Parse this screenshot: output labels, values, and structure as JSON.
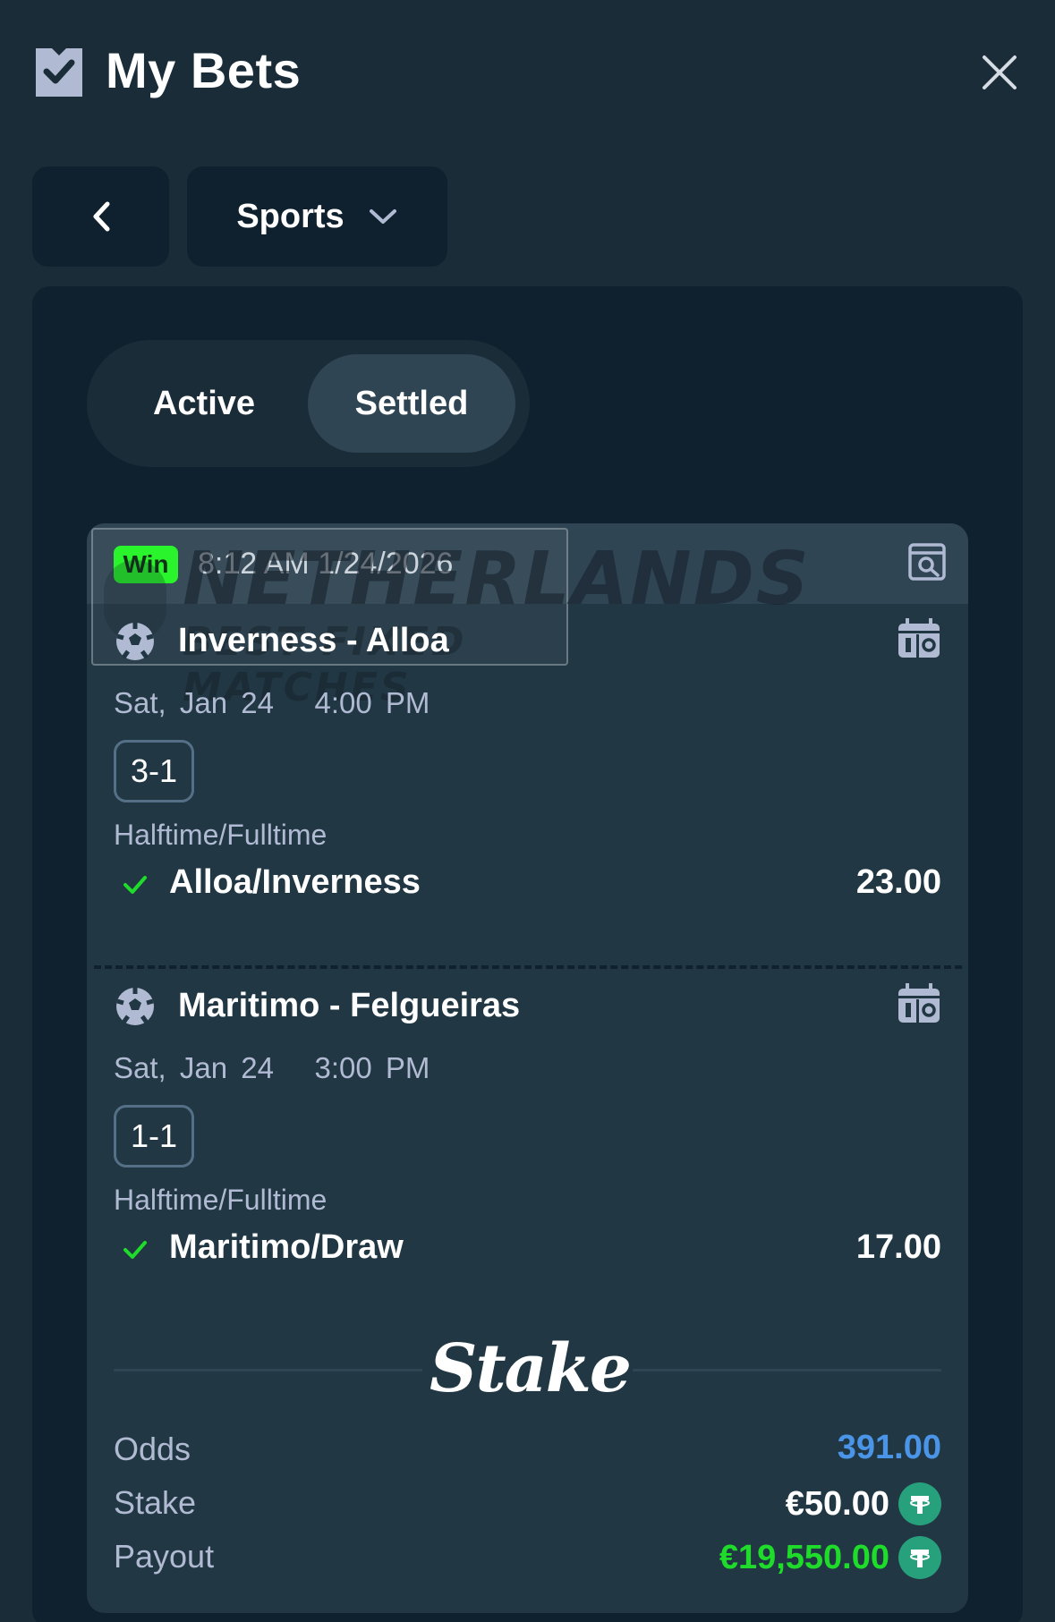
{
  "header": {
    "title": "My Bets",
    "icon": "ticket-icon",
    "close_icon": "close-icon"
  },
  "nav": {
    "back_icon": "chevron-left-icon",
    "sports_label": "Sports",
    "sports_icon": "chevron-down-icon"
  },
  "tabs": [
    {
      "label": "Active",
      "selected": false
    },
    {
      "label": "Settled",
      "selected": true
    }
  ],
  "bet": {
    "status": "Win",
    "status_color": "#1fff20",
    "placed_at": "8:12 AM 1/24/2026",
    "watermark": {
      "line1": "NETHERLANDS",
      "line2": "BEST FIXED MATCHES"
    },
    "legs": [
      {
        "match": "Inverness - Alloa",
        "date": "Sat, Jan 24",
        "time": "4:00 PM",
        "score": "3-1",
        "market": "Halftime/Fulltime",
        "selection": "Alloa/Inverness",
        "odds": "23.00"
      },
      {
        "match": "Maritimo - Felgueiras",
        "date": "Sat, Jan 24",
        "time": "3:00 PM",
        "score": "1-1",
        "market": "Halftime/Fulltime",
        "selection": "Maritimo/Draw",
        "odds": "17.00"
      }
    ],
    "brand": "Stake",
    "summary": {
      "odds_label": "Odds",
      "odds_value": "391.00",
      "stake_label": "Stake",
      "stake_value": "€50.00",
      "payout_label": "Payout",
      "payout_value": "€19,550.00",
      "currency_icon": "tether-coin-icon"
    }
  },
  "colors": {
    "background": "#1a2c38",
    "panel": "#0f212e",
    "card": "#213743",
    "odds_blue": "#4a95e8",
    "payout_green": "#1fdc2b",
    "coin_green": "#26a17b"
  }
}
